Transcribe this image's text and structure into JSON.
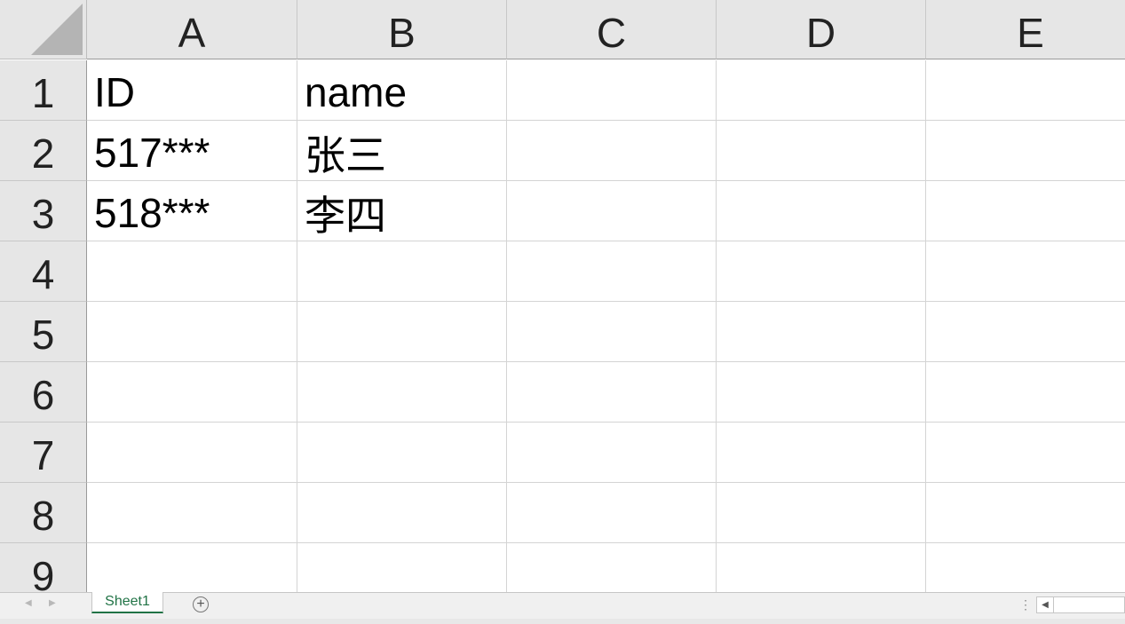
{
  "sheet": {
    "columns": [
      "A",
      "B",
      "C",
      "D",
      "E"
    ],
    "rows": [
      "1",
      "2",
      "3",
      "4",
      "5",
      "6",
      "7",
      "8",
      "9"
    ],
    "cells": [
      [
        "ID",
        "name",
        "",
        "",
        ""
      ],
      [
        "517***",
        "张三",
        "",
        "",
        ""
      ],
      [
        "518***",
        "李四",
        "",
        "",
        ""
      ],
      [
        "",
        "",
        "",
        "",
        ""
      ],
      [
        "",
        "",
        "",
        "",
        ""
      ],
      [
        "",
        "",
        "",
        "",
        ""
      ],
      [
        "",
        "",
        "",
        "",
        ""
      ],
      [
        "",
        "",
        "",
        "",
        ""
      ],
      [
        "",
        "",
        "",
        "",
        ""
      ]
    ]
  },
  "tabs": {
    "active_sheet": "Sheet1",
    "add_icon": "plus-circle-icon",
    "add_glyph": "+",
    "prev_glyph": "◀",
    "next_glyph": "▶",
    "more_glyph": "⋮",
    "accent_color": "#217346"
  }
}
